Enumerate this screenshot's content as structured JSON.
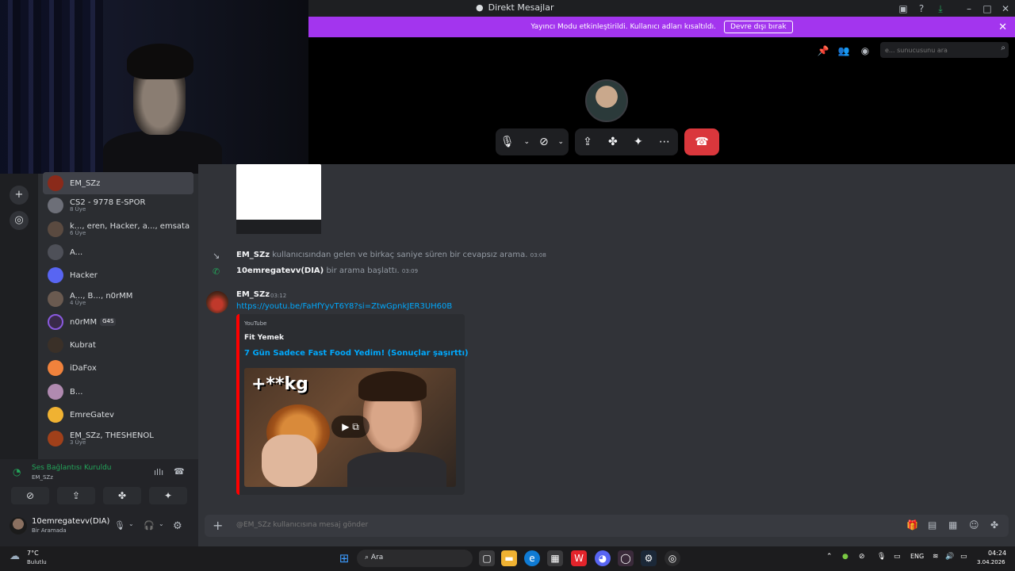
{
  "window": {
    "title": "Direkt Mesajlar"
  },
  "banner": {
    "text": "Yayıncı Modu etkinleştirildi. Kullanıcı adları kısaltıldı.",
    "button": "Devre dışı bırak"
  },
  "search": {
    "placeholder": "e... sunucusunu ara"
  },
  "dm_list": [
    {
      "name": "EM_SZz",
      "sub": ""
    },
    {
      "name": "CS2 - 9778 E-SPOR",
      "sub": "8 Üye"
    },
    {
      "name": "k..., eren, Hacker, a..., emsata",
      "sub": "6 Üye"
    },
    {
      "name": "A...",
      "sub": ""
    },
    {
      "name": "Hacker",
      "sub": ""
    },
    {
      "name": "A..., B..., n0rMM",
      "sub": "4 Üye"
    },
    {
      "name": "n0rMM",
      "sub": "",
      "badge": "G4S"
    },
    {
      "name": "Kubrat",
      "sub": ""
    },
    {
      "name": "iDaFox",
      "sub": ""
    },
    {
      "name": "B...",
      "sub": ""
    },
    {
      "name": "EmreGatev",
      "sub": ""
    },
    {
      "name": "EM_SZz, THESHENOL",
      "sub": "3 Üye"
    }
  ],
  "voice": {
    "status": "Ses Bağlantısı Kuruldu",
    "channel": "EM_SZz"
  },
  "user": {
    "name": "10emregatevv(DIA)",
    "status": "Bir Aramada"
  },
  "chat": {
    "system1": {
      "author": "EM_SZz",
      "text": "kullanıcısından gelen ve birkaç saniye süren bir cevapsız arama.",
      "time": "03:08"
    },
    "system2": {
      "author": "10emregatevv(DIA)",
      "text": "bir arama başlattı.",
      "time": "03:09"
    },
    "message": {
      "author": "EM_SZz",
      "time": "03:12",
      "link": "https://youtu.be/FaHfYyvT6Y8?si=ZtwGpnkJER3UH60B",
      "embed": {
        "provider": "YouTube",
        "author": "Fit Yemek",
        "title": "7 Gün Sadece Fast Food Yedim! (Sonuçlar şaşırttı)",
        "thumb_text": "+**kg"
      }
    },
    "input_placeholder": "@EM_SZz kullanıcısına mesaj gönder"
  },
  "taskbar": {
    "weather_temp": "7°C",
    "weather_desc": "Bulutlu",
    "search": "Ara",
    "lang": "ENG",
    "time": "04:24",
    "date": "3.04.2026"
  },
  "colors": {
    "banner": "#a335ee",
    "hangup": "#da373c",
    "link": "#00a8fc",
    "connected": "#23a55a"
  }
}
